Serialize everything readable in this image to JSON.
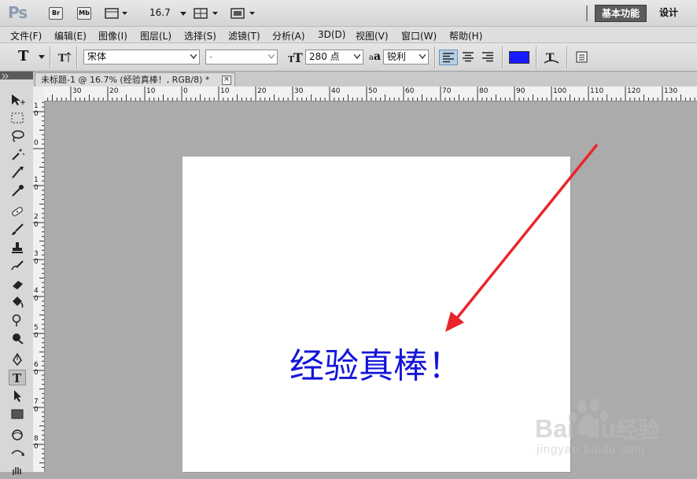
{
  "app": {
    "logo": "Ps",
    "zoom": "16.7",
    "bridge_label": "Br",
    "mini_bridge_label": "Mb"
  },
  "workspace": {
    "active": "基本功能",
    "other": "设计"
  },
  "menus": [
    "文件(F)",
    "编辑(E)",
    "图像(I)",
    "图层(L)",
    "选择(S)",
    "滤镜(T)",
    "分析(A)",
    "3D(D)",
    "视图(V)",
    "窗口(W)",
    "帮助(H)"
  ],
  "options": {
    "tool_glyph": "T",
    "font_family": "宋体",
    "font_style": "-",
    "font_size": "280 点",
    "aa_icon_text": "a",
    "antialias": "锐利",
    "text_color": "#1a1aff"
  },
  "document": {
    "tab_title": "未标题-1 @ 16.7% (经验真棒！, RGB/8) *",
    "close_glyph": "×",
    "canvas_text": "经验真棒！"
  },
  "rulers": {
    "h_ticks": [
      "30",
      "20",
      "10",
      "0",
      "10",
      "20",
      "30",
      "40",
      "50",
      "60",
      "70",
      "80",
      "90",
      "100",
      "110",
      "120",
      "130"
    ],
    "v_ticks": [
      "1\n0",
      "0",
      "1\n0",
      "2\n0",
      "3\n0",
      "4\n0",
      "5\n0",
      "6\n0",
      "7\n0",
      "8\n0"
    ]
  },
  "watermark": {
    "brand_a": "Bai",
    "brand_b": "du",
    "brand_c": "经验",
    "url": "jingyan.baidu.com"
  },
  "annotation": {
    "arrow_color": "#e8262b"
  }
}
